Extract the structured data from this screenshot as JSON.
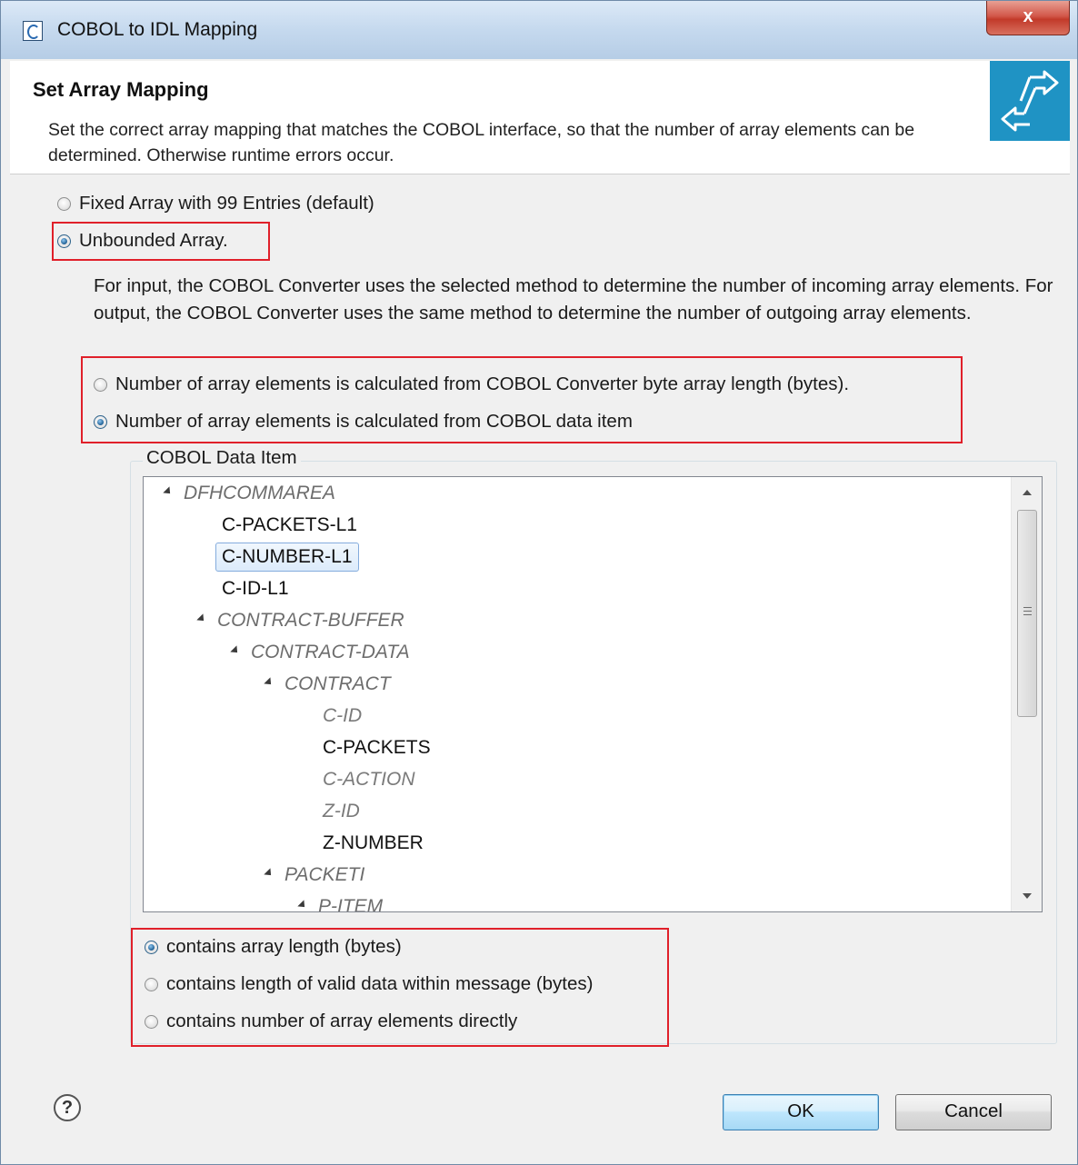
{
  "window": {
    "title": "COBOL to IDL Mapping",
    "close_label": "x"
  },
  "header": {
    "title": "Set Array Mapping",
    "description": "Set the correct array mapping that matches the COBOL interface, so that the number of array elements can be determined. Otherwise runtime errors occur."
  },
  "array_type": {
    "fixed_label": "Fixed Array with 99 Entries (default)",
    "fixed_selected": false,
    "unbounded_label": "Unbounded Array.",
    "unbounded_selected": true
  },
  "info_text": "For input, the COBOL Converter uses the selected method to determine the number of incoming array elements. For output, the COBOL Converter uses the same method to determine the number of outgoing array elements.",
  "calculation_method": {
    "byte_length_label": "Number of array elements is calculated from COBOL Converter byte array length (bytes).",
    "data_item_label": "Number of array elements is calculated from COBOL data item",
    "selected": "data_item"
  },
  "data_item_group": {
    "label": "COBOL Data Item",
    "tree": [
      {
        "label": "DFHCOMMAREA",
        "kind": "group"
      },
      {
        "label": "C-PACKETS-L1",
        "kind": "leaf"
      },
      {
        "label": "C-NUMBER-L1",
        "kind": "leaf",
        "selected": true
      },
      {
        "label": "C-ID-L1",
        "kind": "leaf"
      },
      {
        "label": "CONTRACT-BUFFER",
        "kind": "group"
      },
      {
        "label": "CONTRACT-DATA",
        "kind": "group"
      },
      {
        "label": "CONTRACT",
        "kind": "group"
      },
      {
        "label": "C-ID",
        "kind": "leaf-disabled"
      },
      {
        "label": "C-PACKETS",
        "kind": "leaf"
      },
      {
        "label": "C-ACTION",
        "kind": "leaf-disabled"
      },
      {
        "label": "Z-ID",
        "kind": "leaf-disabled"
      },
      {
        "label": "Z-NUMBER",
        "kind": "leaf"
      },
      {
        "label": "PACKETI",
        "kind": "group"
      },
      {
        "label": "P-ITEM",
        "kind": "group"
      }
    ],
    "contains_options": [
      {
        "label": "contains array length (bytes)",
        "selected": true
      },
      {
        "label": "contains length of valid data within message (bytes)",
        "selected": false
      },
      {
        "label": "contains number of array elements directly",
        "selected": false
      }
    ]
  },
  "footer": {
    "help_label": "?",
    "ok_label": "OK",
    "cancel_label": "Cancel"
  },
  "colors": {
    "highlight_box": "#e0202a",
    "banner_icon": "#1f93c4",
    "selection": "#dcebfb"
  }
}
